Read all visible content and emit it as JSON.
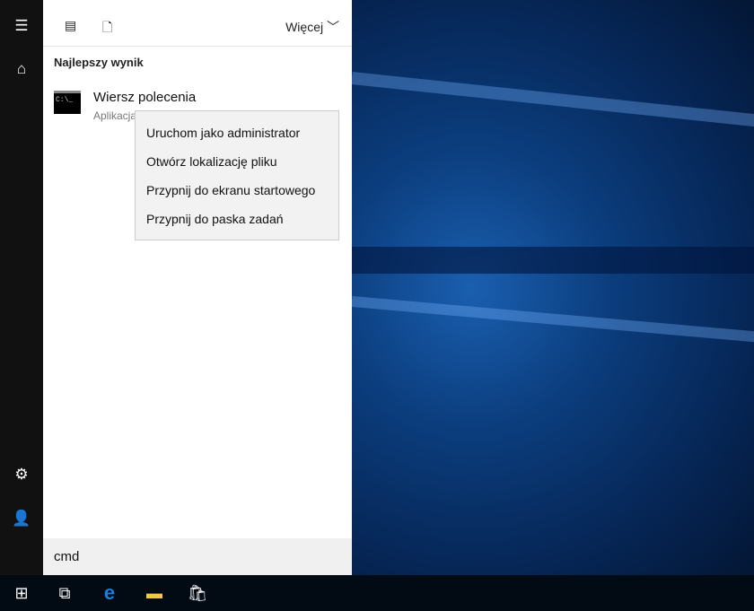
{
  "panel": {
    "more_label": "Więcej",
    "section_title": "Najlepszy wynik",
    "result": {
      "title": "Wiersz polecenia",
      "subtitle": "Aplikacja",
      "icon_text": "C:\\_"
    }
  },
  "context_menu": [
    "Uruchom jako administrator",
    "Otwórz lokalizację pliku",
    "Przypnij do ekranu startowego",
    "Przypnij do paska zadań"
  ],
  "search": {
    "value": "cmd"
  }
}
